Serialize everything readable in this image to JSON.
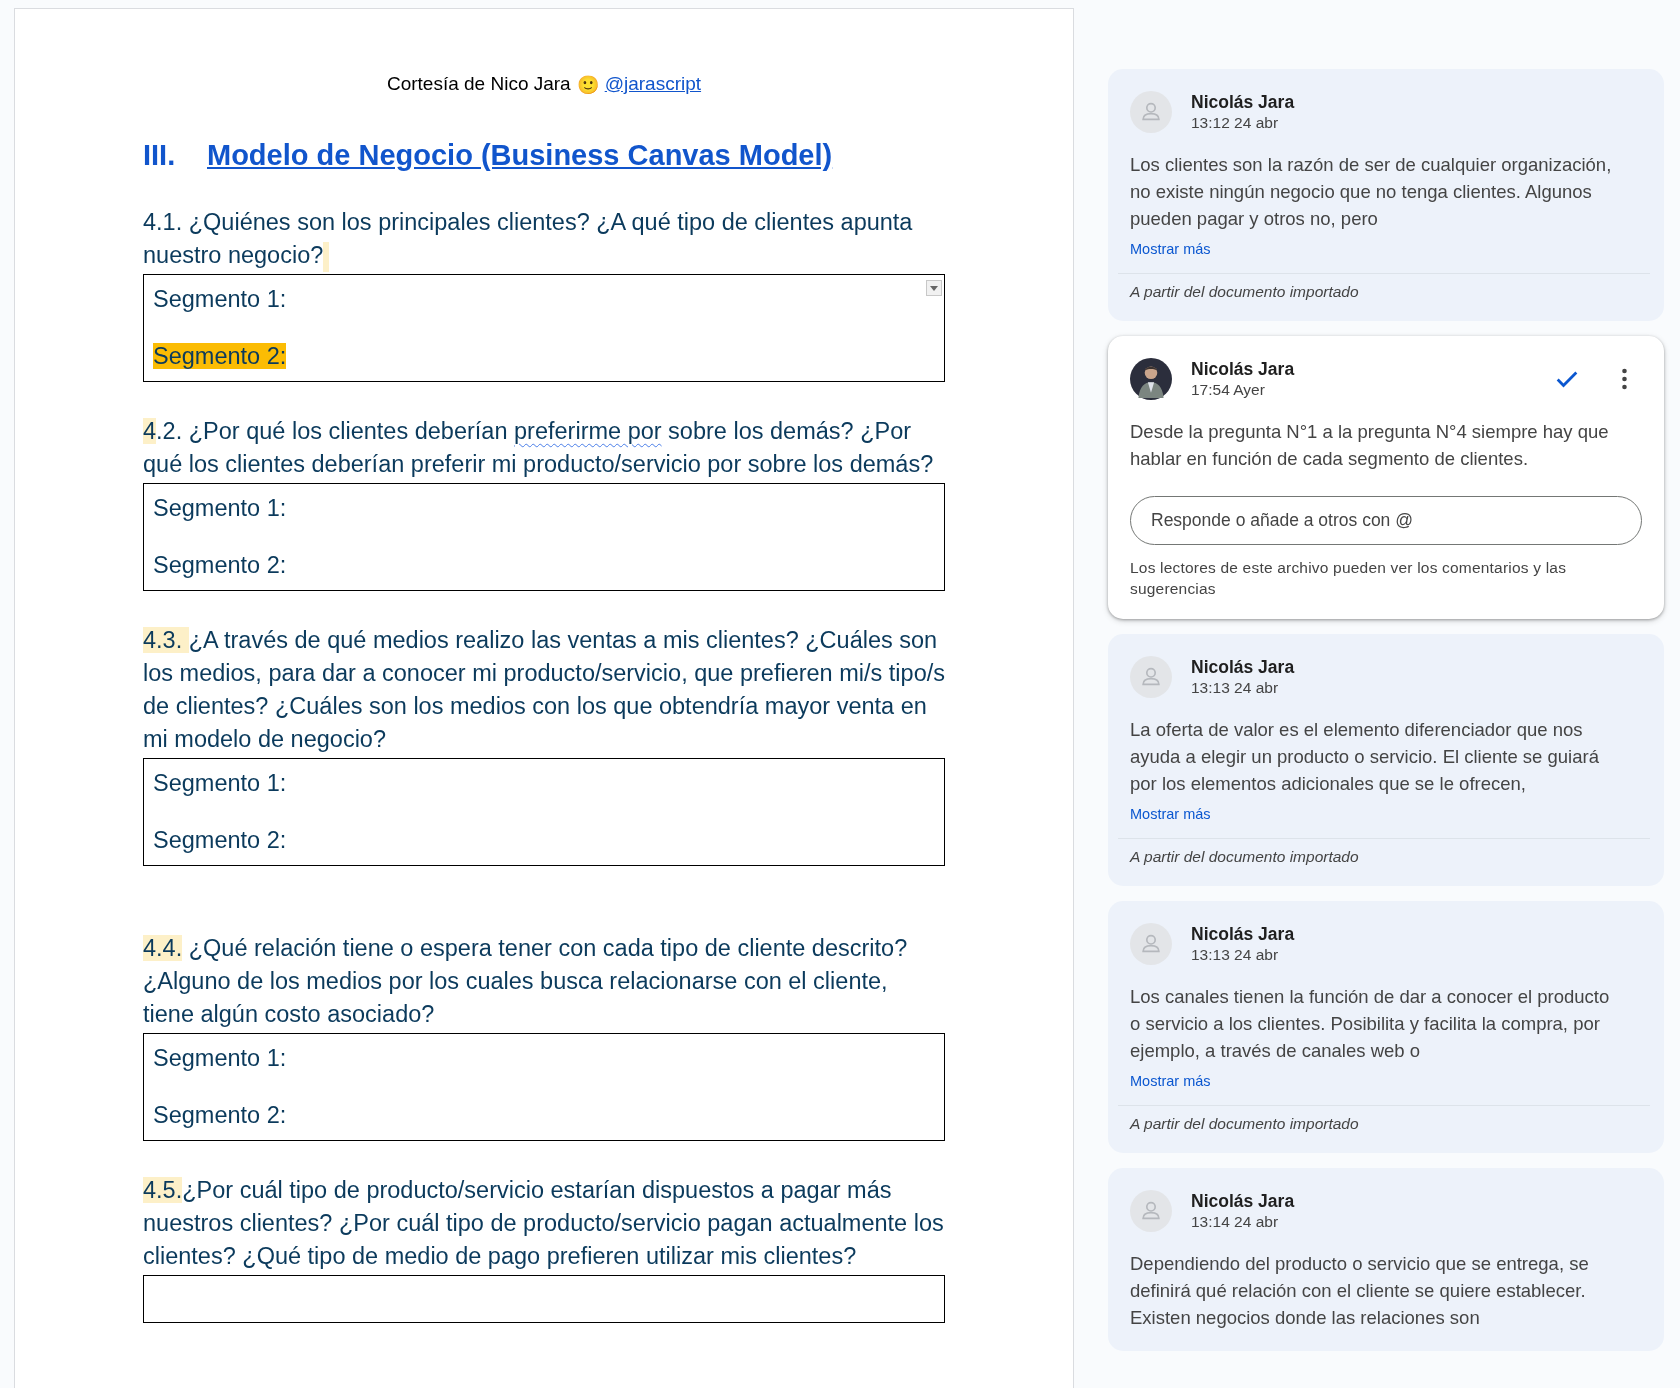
{
  "document": {
    "courtesy": {
      "text": "Cortesía de Nico Jara",
      "emoji": "🙂",
      "link": "@jarascript"
    },
    "heading": {
      "number": "III.",
      "title": "Modelo de Negocio (Business Canvas Model)"
    },
    "questions": [
      {
        "comment_anchor": true,
        "spans": [
          {
            "text": "4.1. ¿Quiénes son los principales clientes? ¿A qué tipo de clientes apunta nuestro negocio?",
            "highlight": false,
            "spellcheck": false
          }
        ],
        "answer": {
          "dropdown": true,
          "lines": [
            {
              "text": "Segmento 1:",
              "highlight": false
            },
            {
              "text": "Segmento 2:",
              "highlight": true
            }
          ]
        }
      },
      {
        "comment_anchor": false,
        "spans": [
          {
            "text": "4",
            "highlight": true,
            "spellcheck": false
          },
          {
            "text": ".2. ¿Por qué los clientes deberían ",
            "highlight": false,
            "spellcheck": false
          },
          {
            "text": "preferirme por",
            "highlight": false,
            "spellcheck": true
          },
          {
            "text": " sobre los demás? ¿Por qué los clientes deberían preferir mi producto/servicio por sobre los demás?",
            "highlight": false,
            "spellcheck": false
          }
        ],
        "answer": {
          "dropdown": false,
          "lines": [
            {
              "text": "Segmento 1:",
              "highlight": false
            },
            {
              "text": "Segmento 2:",
              "highlight": false
            }
          ]
        }
      },
      {
        "comment_anchor": false,
        "spans": [
          {
            "text": "4.3. ",
            "highlight": true,
            "spellcheck": false
          },
          {
            "text": " ¿A través de qué medios realizo las ventas a mis clientes? ¿Cuáles son los medios, para dar a conocer mi producto/servicio, que prefieren mi/s tipo/s de clientes? ¿Cuáles son los medios con los que obtendría mayor venta en mi modelo de negocio?",
            "highlight": false,
            "spellcheck": false
          }
        ],
        "answer": {
          "dropdown": false,
          "lines": [
            {
              "text": "Segmento 1:",
              "highlight": false
            },
            {
              "text": "Segmento 2:",
              "highlight": false
            }
          ]
        }
      },
      {
        "comment_anchor": false,
        "spans": [
          {
            "text": "4.4.",
            "highlight": true,
            "spellcheck": false
          },
          {
            "text": " ¿Qué relación tiene o espera tener con cada tipo de cliente descrito? ¿Alguno de los medios por los cuales busca relacionarse con el cliente, tiene algún costo asociado?",
            "highlight": false,
            "spellcheck": false
          }
        ],
        "answer": {
          "dropdown": false,
          "lines": [
            {
              "text": "Segmento 1:",
              "highlight": false
            },
            {
              "text": "Segmento 2:",
              "highlight": false
            }
          ]
        }
      },
      {
        "comment_anchor": false,
        "spans": [
          {
            "text": "4.5.",
            "highlight": true,
            "spellcheck": false
          },
          {
            "text": "¿Por cuál tipo de producto/servicio estarían dispuestos a pagar más nuestros clientes? ¿Por cuál tipo de producto/servicio pagan actualmente los clientes? ¿Qué tipo de medio de pago prefieren utilizar mis clientes?",
            "highlight": false,
            "spellcheck": false
          }
        ],
        "answer": {
          "dropdown": false
        }
      }
    ]
  },
  "comments": [
    {
      "active": false,
      "avatar": {
        "kind": "placeholder"
      },
      "author": "Nicolás Jara",
      "time": "13:12 24 abr",
      "body": "Los clientes son la razón de ser de cualquier organización, no existe ningún negocio que no tenga clientes. Algunos pueden pagar y otros no, pero",
      "show_more": "Mostrar más",
      "footer": "A partir del documento importado"
    },
    {
      "active": true,
      "author": "Nicolás Jara",
      "time": "17:54 Ayer",
      "body": "Desde la pregunta N°1 a la pregunta N°4 siempre hay que hablar en función de cada segmento de clientes.",
      "reply": {
        "placeholder": "Responde o añade a otros con @"
      },
      "notice": "Los lectores de este archivo pueden ver los comentarios y las sugerencias"
    },
    {
      "active": false,
      "avatar": {
        "kind": "placeholder"
      },
      "author": "Nicolás Jara",
      "time": "13:13 24 abr",
      "body": "La oferta de valor es el elemento diferenciador que nos ayuda a elegir un producto o servicio. El cliente se guiará por los elementos adicionales que se le ofrecen,",
      "show_more": "Mostrar más",
      "footer": "A partir del documento importado"
    },
    {
      "active": false,
      "avatar": {
        "kind": "placeholder"
      },
      "author": "Nicolás Jara",
      "time": "13:13 24 abr",
      "body": "Los canales tienen la función de dar a conocer el producto o servicio a los clientes. Posibilita y facilita la compra, por ejemplo, a través de canales web o",
      "show_more": "Mostrar más",
      "footer": "A partir del documento importado"
    },
    {
      "active": false,
      "avatar": {
        "kind": "placeholder"
      },
      "author": "Nicolás Jara",
      "time": "13:14 24 abr",
      "body": "Dependiendo del producto o servicio que se entrega, se definirá qué relación con el cliente se quiere establecer. Existen negocios donde las relaciones son"
    }
  ]
}
